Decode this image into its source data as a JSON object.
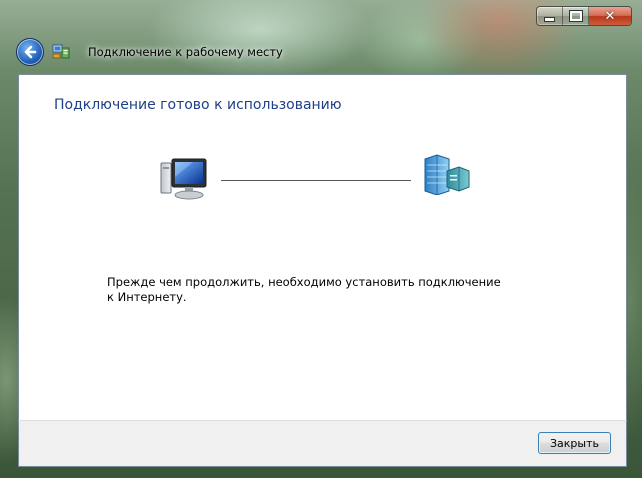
{
  "window": {
    "title": "Подключение к рабочему месту",
    "caption_buttons": {
      "minimize_icon": "minimize-icon",
      "maximize_icon": "maximize-icon",
      "close_glyph": "✕"
    }
  },
  "main": {
    "heading": "Подключение готово к использованию",
    "diagram": {
      "left_icon": "computer-icon",
      "right_icon": "workplace-network-icon"
    },
    "message": "Прежде чем продолжить, необходимо установить подключение к Интернету."
  },
  "footer": {
    "close_label": "Закрыть"
  },
  "colors": {
    "heading": "#1e3f8a",
    "button_border": "#3c7fb1",
    "close_caption": "#c9472a"
  }
}
